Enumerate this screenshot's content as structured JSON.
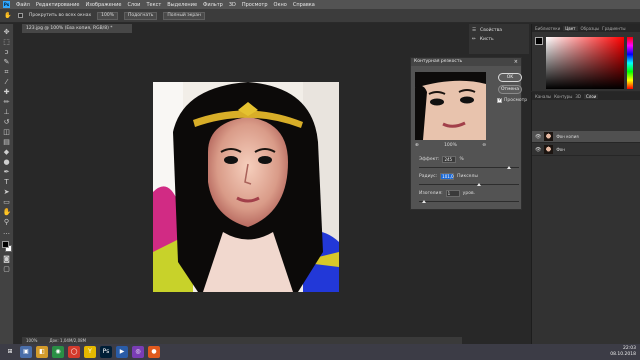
{
  "menubar": {
    "logo": "Ps",
    "items": [
      "Файл",
      "Редактирование",
      "Изображение",
      "Слои",
      "Текст",
      "Выделение",
      "Фильтр",
      "3D",
      "Просмотр",
      "Окно",
      "Справка"
    ]
  },
  "options_bar": {
    "tool_hint": "Прокрутить во всех окнах",
    "zoom_value": "100%",
    "fit_button": "Подогнать",
    "fullscreen_button": "Полный экран"
  },
  "document": {
    "tab_title": "123.jpg @ 100% (Ева копия, RGB/8) *",
    "status_zoom": "100%",
    "status_doc": "Док: 1,04М/2,08М"
  },
  "dialog": {
    "title": "Контурная резкость",
    "close_glyph": "×",
    "ok_label": "OK",
    "cancel_label": "Отмена",
    "preview_label": "Просмотр",
    "zoom_percent": "100%",
    "amount_label": "Эффект:",
    "amount_value": "245",
    "amount_unit": "%",
    "amount_level": 0.9,
    "radius_label": "Радиус:",
    "radius_value": "101,0",
    "radius_unit": "Пикселы",
    "radius_level": 0.6,
    "threshold_label": "Изогелия:",
    "threshold_value": "1",
    "threshold_unit": "уров.",
    "threshold_level": 0.05
  },
  "dock": {
    "properties_label": "Свойства",
    "brush_label": "Кисть"
  },
  "color_panel": {
    "tabs": [
      "Библиотеки",
      "Цвет",
      "Образцы",
      "Градиенты"
    ],
    "active": "Цвет"
  },
  "layers_panel": {
    "tabs": [
      "Каналы",
      "Контуры",
      "3D",
      "Слои"
    ],
    "active": "Слои",
    "layers": [
      {
        "name": "Фон копия",
        "selected": true
      },
      {
        "name": "Фон",
        "selected": false
      }
    ]
  },
  "taskbar": {
    "time": "22:03",
    "date": "08.10.2018",
    "apps": [
      {
        "glyph": "⊞",
        "color": "#3c3c46"
      },
      {
        "glyph": "▣",
        "color": "#4a6ea9"
      },
      {
        "glyph": "◧",
        "color": "#d39b2b"
      },
      {
        "glyph": "◉",
        "color": "#2a8f45"
      },
      {
        "glyph": "◯",
        "color": "#d33a2c"
      },
      {
        "glyph": "Y",
        "color": "#e6b800"
      },
      {
        "glyph": "Ps",
        "color": "#001e36"
      },
      {
        "glyph": "▶",
        "color": "#2a5ca8"
      },
      {
        "glyph": "◎",
        "color": "#7a3db5"
      },
      {
        "glyph": "●",
        "color": "#e05a1e"
      }
    ]
  }
}
